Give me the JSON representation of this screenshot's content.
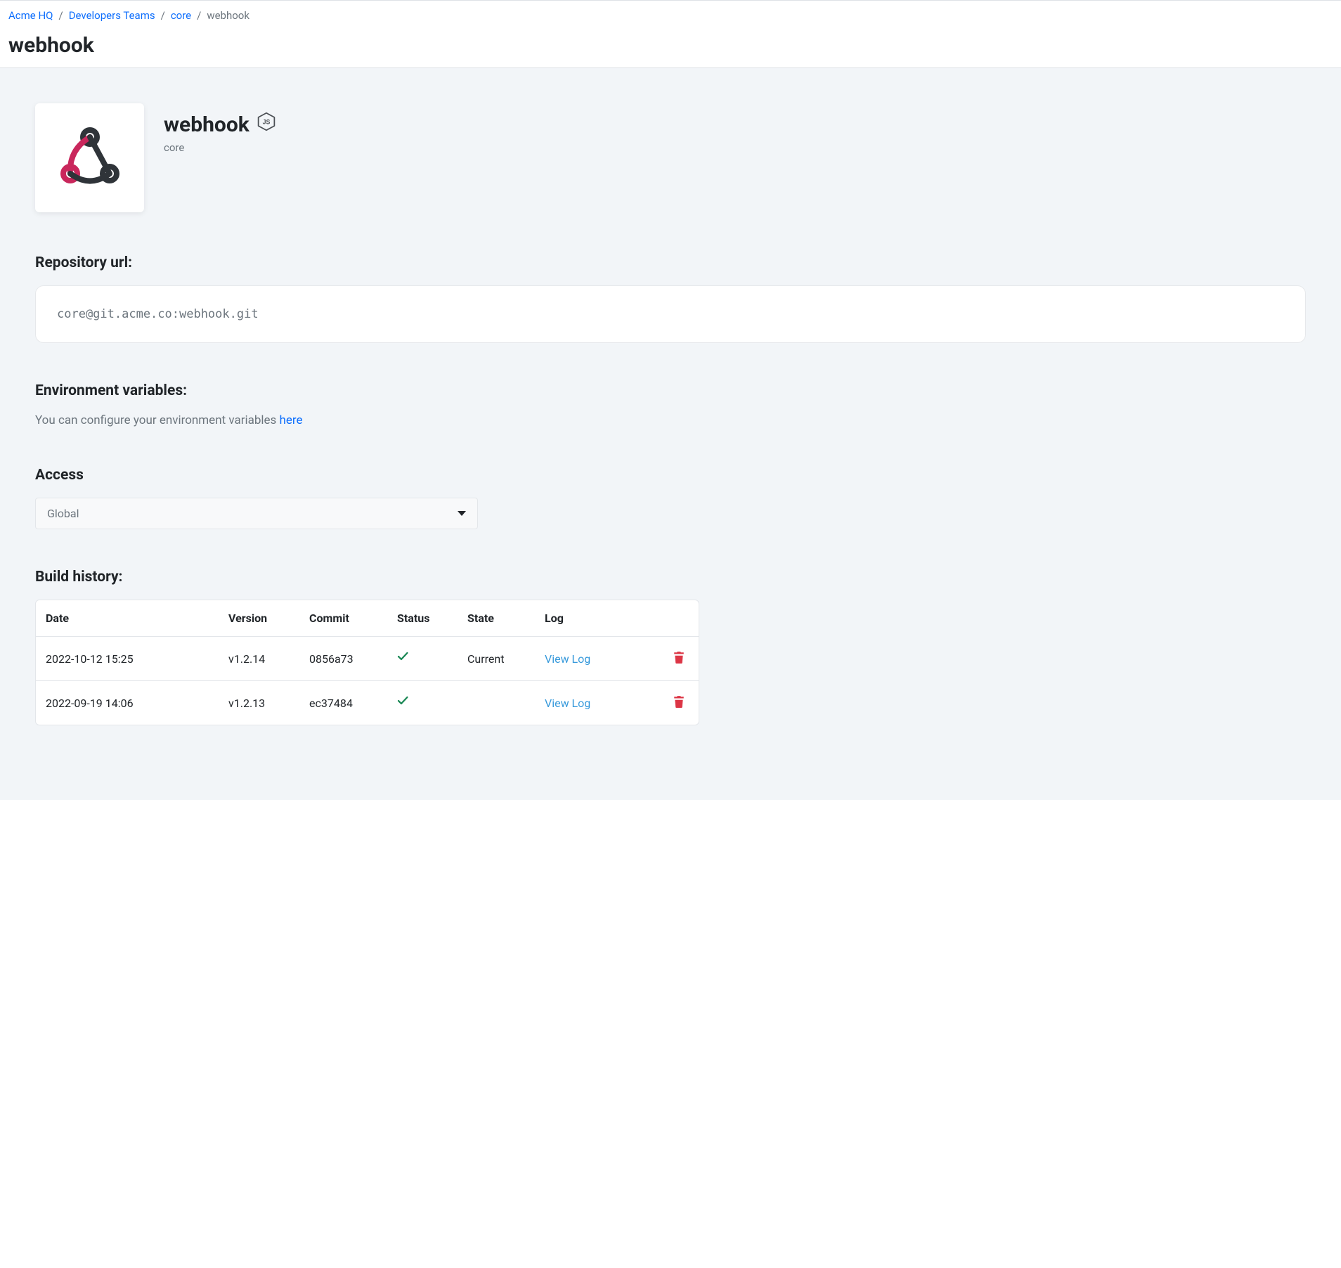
{
  "breadcrumb": {
    "items": [
      {
        "label": "Acme HQ",
        "link": true
      },
      {
        "label": "Developers Teams",
        "link": true
      },
      {
        "label": "core",
        "link": true
      },
      {
        "label": "webhook",
        "link": false
      }
    ]
  },
  "page_title": "webhook",
  "service": {
    "name": "webhook",
    "team": "core",
    "runtime_icon": "nodejs-icon"
  },
  "repo": {
    "heading": "Repository url:",
    "url": "core@git.acme.co:webhook.git"
  },
  "env": {
    "heading": "Environment variables:",
    "text_prefix": "You can configure your environment variables ",
    "link_label": "here"
  },
  "access": {
    "heading": "Access",
    "selected": "Global"
  },
  "build_history": {
    "heading": "Build history:",
    "columns": {
      "date": "Date",
      "version": "Version",
      "commit": "Commit",
      "status": "Status",
      "state": "State",
      "log": "Log"
    },
    "log_link_label": "View Log",
    "rows": [
      {
        "date": "2022-10-12 15:25",
        "version": "v1.2.14",
        "commit": "0856a73",
        "status": "success",
        "state": "Current"
      },
      {
        "date": "2022-09-19 14:06",
        "version": "v1.2.13",
        "commit": "ec37484",
        "status": "success",
        "state": ""
      }
    ]
  }
}
